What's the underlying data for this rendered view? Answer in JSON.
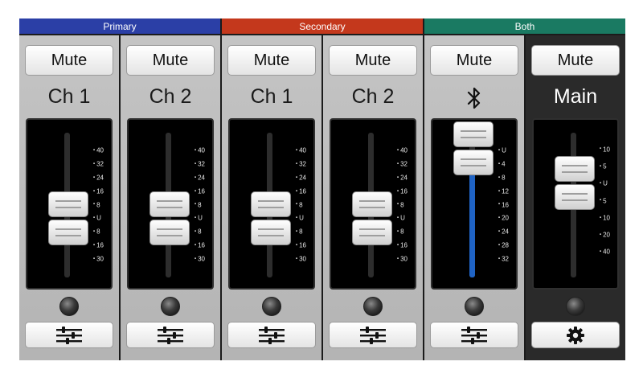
{
  "groups": [
    {
      "label": "Primary",
      "color": "#2b3fa6"
    },
    {
      "label": "Secondary",
      "color": "#c4381c"
    },
    {
      "label": "Both",
      "color": "#1a7a62"
    }
  ],
  "strips": [
    {
      "mute_label": "Mute",
      "label": "Ch 1",
      "scale": [
        "40",
        "32",
        "24",
        "16",
        "8",
        "U",
        "8",
        "16",
        "30"
      ],
      "bottom_icon": "sliders-icon"
    },
    {
      "mute_label": "Mute",
      "label": "Ch 2",
      "scale": [
        "40",
        "32",
        "24",
        "16",
        "8",
        "U",
        "8",
        "16",
        "30"
      ],
      "bottom_icon": "sliders-icon"
    },
    {
      "mute_label": "Mute",
      "label": "Ch 1",
      "scale": [
        "40",
        "32",
        "24",
        "16",
        "8",
        "U",
        "8",
        "16",
        "30"
      ],
      "bottom_icon": "sliders-icon"
    },
    {
      "mute_label": "Mute",
      "label": "Ch 2",
      "scale": [
        "40",
        "32",
        "24",
        "16",
        "8",
        "U",
        "8",
        "16",
        "30"
      ],
      "bottom_icon": "sliders-icon"
    },
    {
      "mute_label": "Mute",
      "label_icon": "bluetooth-icon",
      "scale": [
        "U",
        "4",
        "8",
        "12",
        "16",
        "20",
        "24",
        "28",
        "32"
      ],
      "bottom_icon": "sliders-icon",
      "fill_color": "#1f63c4"
    },
    {
      "mute_label": "Mute",
      "label": "Main",
      "scale": [
        "10",
        "5",
        "U",
        "5",
        "10",
        "20",
        "40"
      ],
      "bottom_icon": "gear-icon"
    }
  ]
}
